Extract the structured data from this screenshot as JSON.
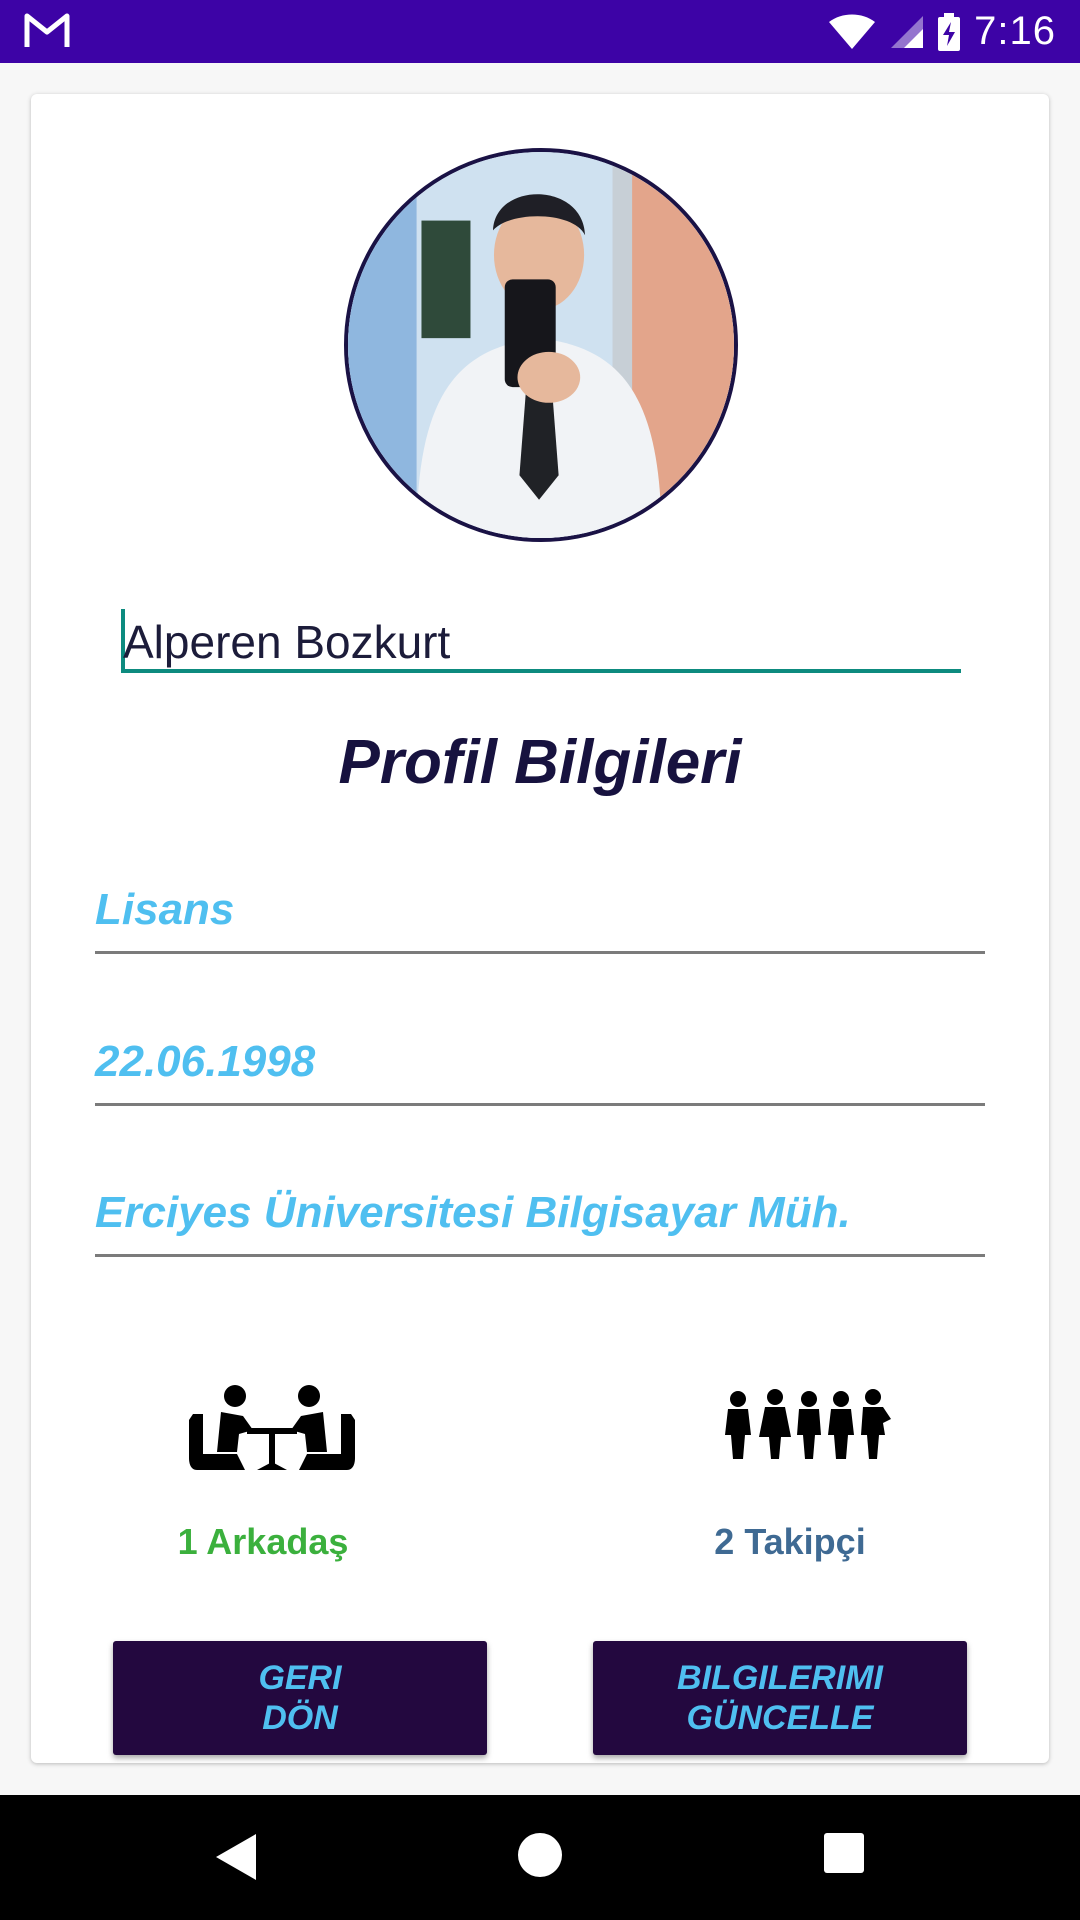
{
  "status_bar": {
    "time": "7:16",
    "icons": [
      "gmail-icon",
      "wifi-icon",
      "signal-icon",
      "battery-charging-icon"
    ],
    "background": "#3d03a6"
  },
  "profile": {
    "avatar_icon": "profile-photo",
    "name_value": "Alperen Bozkurt",
    "section_title": "Profil Bilgileri",
    "education": "Lisans",
    "birth_date": "22.06.1998",
    "school": "Erciyes Üniversitesi Bilgisayar Müh."
  },
  "stats": {
    "friends_icon": "friends-icon",
    "friends_label": "1 Arkadaş",
    "followers_icon": "followers-icon",
    "followers_label": "2 Takipçi"
  },
  "buttons": {
    "back_label": "GERI\nDÖN",
    "update_label": "BILGILERIMI\nGÜNCELLE"
  },
  "nav_bar": {
    "icons": [
      "back-triangle-icon",
      "home-circle-icon",
      "recent-square-icon"
    ]
  },
  "colors": {
    "accent_teal": "#0d8b7f",
    "field_text": "#4fbff0",
    "title": "#17123f",
    "button_bg": "#23083f",
    "friends_green": "#3bb03d",
    "followers_blue": "#3f6a93"
  }
}
